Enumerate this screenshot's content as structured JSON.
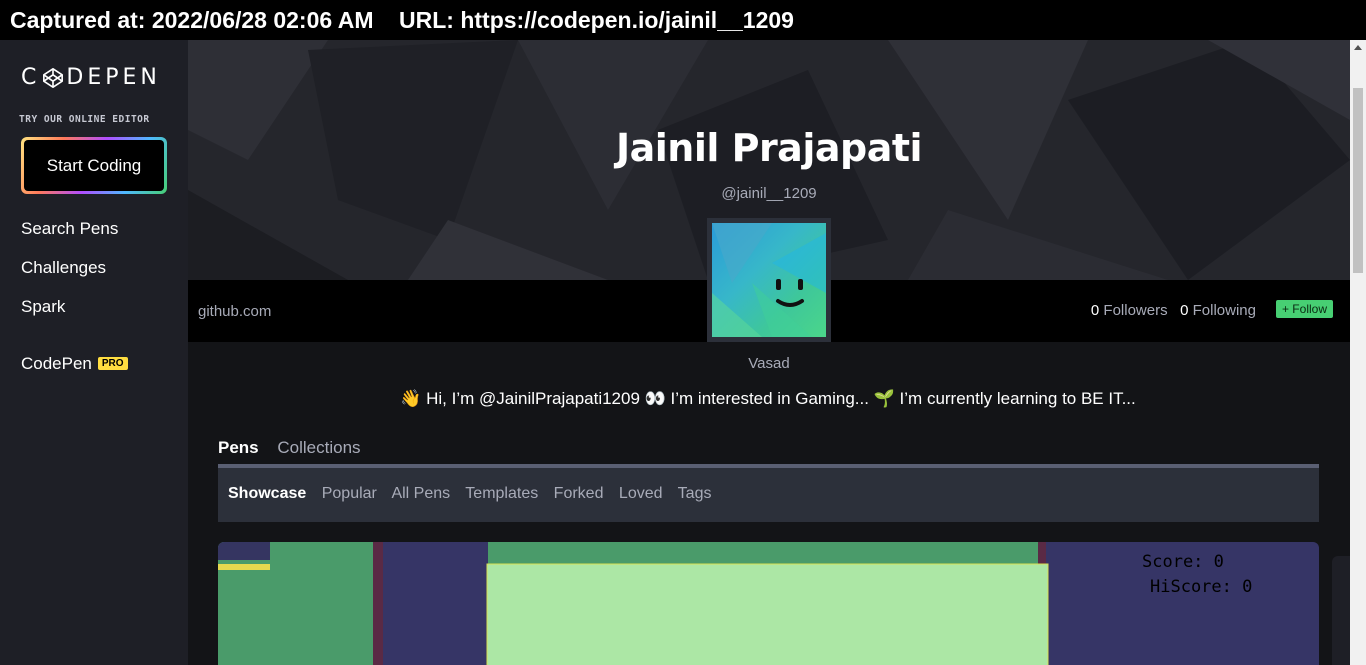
{
  "capture": {
    "text": "Captured at: 2022/06/28 02:06 AM    URL: https://codepen.io/jainil__1209"
  },
  "sidebar": {
    "logo_left": "C",
    "logo_right": "DEPEN",
    "try_label": "TRY OUR ONLINE EDITOR",
    "start_coding": "Start Coding",
    "nav": [
      {
        "label": "Search Pens"
      },
      {
        "label": "Challenges"
      },
      {
        "label": "Spark"
      }
    ],
    "codepen_label": "CodePen",
    "pro_badge": "PRO"
  },
  "profile": {
    "name": "Jainil Prajapati",
    "handle": "@jainil__1209",
    "website": "github.com",
    "followers_count": "0",
    "followers_label": "Followers",
    "following_count": "0",
    "following_label": "Following",
    "follow_button": "+ Follow",
    "location": "Vasad",
    "bio": "👋 Hi, I’m @JainilPrajapati1209 👀 I’m interested in Gaming... 🌱 I’m currently learning to BE IT..."
  },
  "tabs": [
    {
      "label": "Pens"
    },
    {
      "label": "Collections"
    }
  ],
  "subnav": [
    {
      "label": "Showcase"
    },
    {
      "label": "Popular"
    },
    {
      "label": "All Pens"
    },
    {
      "label": "Templates"
    },
    {
      "label": "Forked"
    },
    {
      "label": "Loved"
    },
    {
      "label": "Tags"
    }
  ],
  "preview": {
    "score": "Score: 0",
    "hiscore": "HiScore: 0"
  },
  "colors": {
    "accent_green": "#47cf73",
    "pro_yellow": "#ffdd40",
    "sidebar_bg": "#1e1f26",
    "page_bg": "#131417"
  }
}
